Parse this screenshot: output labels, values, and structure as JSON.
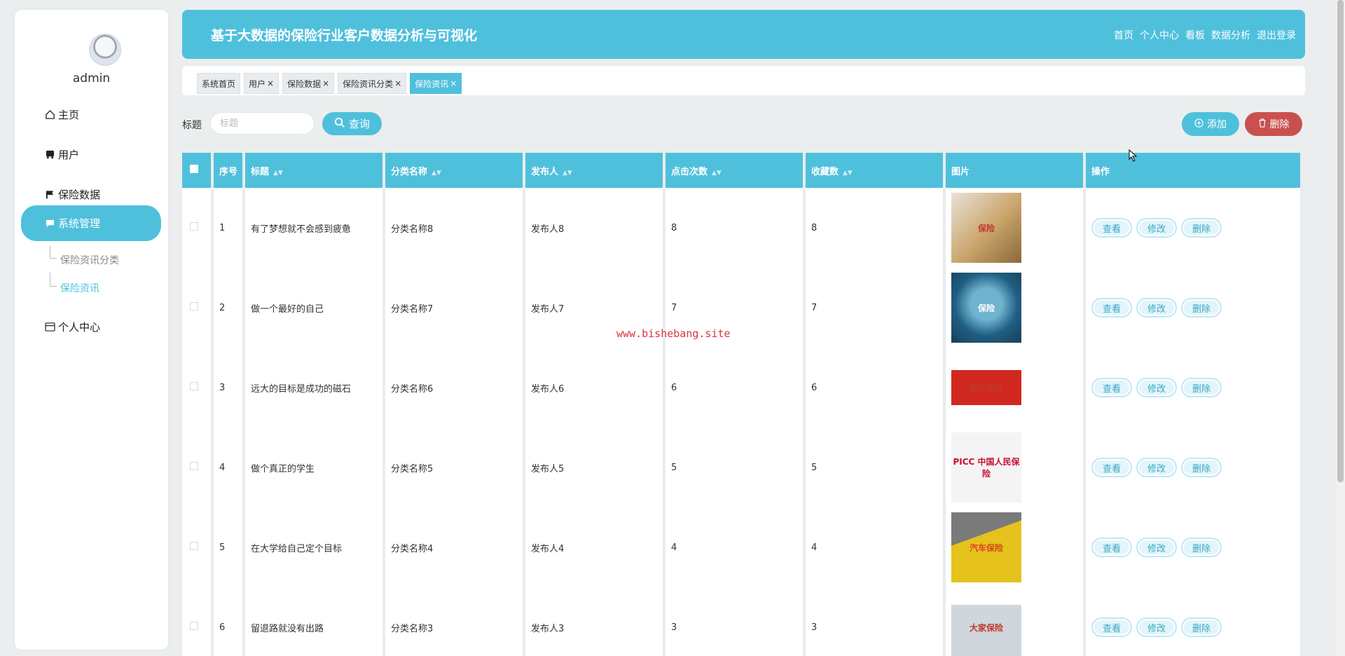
{
  "sidebar": {
    "username": "admin",
    "items": [
      {
        "label": "主页",
        "icon": "home-icon"
      },
      {
        "label": "用户",
        "icon": "user-icon"
      },
      {
        "label": "保险数据",
        "icon": "flag-icon"
      },
      {
        "label": "系统管理",
        "icon": "chat-icon"
      },
      {
        "label": "个人中心",
        "icon": "card-icon"
      }
    ],
    "subitems": [
      "保险资讯分类",
      "保险资讯"
    ]
  },
  "header": {
    "title": "基于大数据的保险行业客户数据分析与可视化",
    "nav": [
      "首页",
      "个人中心",
      "看板",
      "数据分析",
      "退出登录"
    ]
  },
  "tabs": [
    {
      "label": "系统首页",
      "closable": false
    },
    {
      "label": "用户",
      "closable": true
    },
    {
      "label": "保险数据",
      "closable": true
    },
    {
      "label": "保险资讯分类",
      "closable": true
    },
    {
      "label": "保险资讯",
      "closable": true
    }
  ],
  "search": {
    "label": "标题",
    "placeholder": "标题",
    "query_label": "查询",
    "add_label": "添加",
    "delete_label": "删除"
  },
  "table": {
    "headers": [
      "序号",
      "标题",
      "分类名称",
      "发布人",
      "点击次数",
      "收藏数",
      "图片",
      "操作"
    ],
    "op_labels": [
      "查看",
      "修改",
      "删除"
    ],
    "rows": [
      {
        "no": "1",
        "title": "有了梦想就不会感到疲惫",
        "category": "分类名称8",
        "publisher": "发布人8",
        "clicks": "8",
        "favorites": "8",
        "image_text": "保险"
      },
      {
        "no": "2",
        "title": "做一个最好的自己",
        "category": "分类名称7",
        "publisher": "发布人7",
        "clicks": "7",
        "favorites": "7",
        "image_text": "保险"
      },
      {
        "no": "3",
        "title": "远大的目标是成功的磁石",
        "category": "分类名称6",
        "publisher": "发布人6",
        "clicks": "6",
        "favorites": "6",
        "image_text": "医疗保险"
      },
      {
        "no": "4",
        "title": "做个真正的学生",
        "category": "分类名称5",
        "publisher": "发布人5",
        "clicks": "5",
        "favorites": "5",
        "image_text": "PICC 中国人民保险"
      },
      {
        "no": "5",
        "title": "在大学给自己定个目标",
        "category": "分类名称4",
        "publisher": "发布人4",
        "clicks": "4",
        "favorites": "4",
        "image_text": "汽车保险"
      },
      {
        "no": "6",
        "title": "留退路就没有出路",
        "category": "分类名称3",
        "publisher": "发布人3",
        "clicks": "3",
        "favorites": "3",
        "image_text": "大家保险"
      }
    ]
  },
  "watermark": "www.bishebang.site",
  "colors": {
    "accent": "#4fc0dc",
    "danger": "#c9504f",
    "watermark": "#d9363e"
  }
}
